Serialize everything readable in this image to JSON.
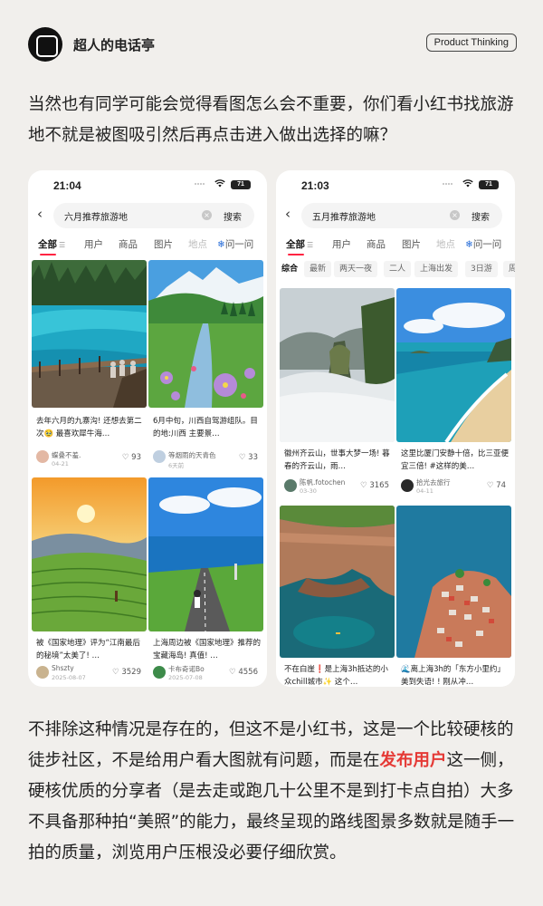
{
  "header": {
    "brand": "超人的电话亭",
    "tag": "Product Thinking",
    "logo_icon": "S-logo-icon"
  },
  "intro": "当然也有同学可能会觉得看图怎么会不重要，你们看小红书找旅游地不就是被图吸引然后再点击进入做出选择的嘛？",
  "phones": [
    {
      "time": "21:04",
      "battery": "71",
      "query": "六月推荐旅游地",
      "search_btn": "搜索",
      "tabs": [
        "全部",
        "用户",
        "商品",
        "图片",
        "地点",
        "问一问"
      ],
      "cards": [
        {
          "title": "去年六月的九寨沟! 还想去第二次🥹 最喜欢犀牛海…",
          "user": "蝶叠不羞.",
          "date": "04-21",
          "likes": "93"
        },
        {
          "title": "6月中旬，川西自驾游组队。目的地:川西 主要景…",
          "user": "等烟雨的天青色",
          "date": "6天前",
          "likes": "33"
        },
        {
          "title": "被《国家地理》评为“江南最后的秘境”太美了! …",
          "user": "Shszty",
          "date": "2025-08-07",
          "likes": "3529"
        },
        {
          "title": "上海周边被《国家地理》推荐的宝藏海岛! 真值! …",
          "user": "卡布奇诺Bo",
          "date": "2025-07-08",
          "likes": "4556"
        }
      ]
    },
    {
      "time": "21:03",
      "battery": "71",
      "query": "五月推荐旅游地",
      "search_btn": "搜索",
      "tabs": [
        "全部",
        "用户",
        "商品",
        "图片",
        "地点",
        "问一问"
      ],
      "chips": [
        "综合",
        "最新",
        "两天一夜",
        "二人",
        "上海出发",
        "3日游",
        "周"
      ],
      "cards": [
        {
          "title": "徽州齐云山，世事大梦一场! 暮春的齐云山，雨…",
          "user": "陈帆.fotochen",
          "date": "03-30",
          "likes": "3165"
        },
        {
          "title": "这里比厦门安静十倍，比三亚便宜三倍! #这样的美…",
          "user": "拾光去旅行",
          "date": "04-11",
          "likes": "74"
        },
        {
          "title": "不在白崖❗是上海3h抵达的小众chill城市✨ 这个…",
          "user": "",
          "date": "",
          "likes": ""
        },
        {
          "title": "🌊离上海3h的「东方小里约」美到失语! ! 刚从冲…",
          "user": "",
          "date": "",
          "likes": ""
        }
      ]
    }
  ],
  "outro": {
    "part1": "不排除这种情况是存在的，但这不是小红书，这是一个比较硬核的徒步社区，不是给用户看大图就有问题，而是在",
    "highlight": "发布用户",
    "part2": "这一侧，硬核优质的分享者（是去走或跑几十公里不是到打卡点自拍）大多不具备那种拍“美照”的能力，最终呈现的路线图景多数就是随手一拍的质量，浏览用户压根没必要仔细欣赏。"
  },
  "colors": {
    "bg": "#f1efec",
    "accent": "#ff2442",
    "highlight": "#e53935"
  }
}
